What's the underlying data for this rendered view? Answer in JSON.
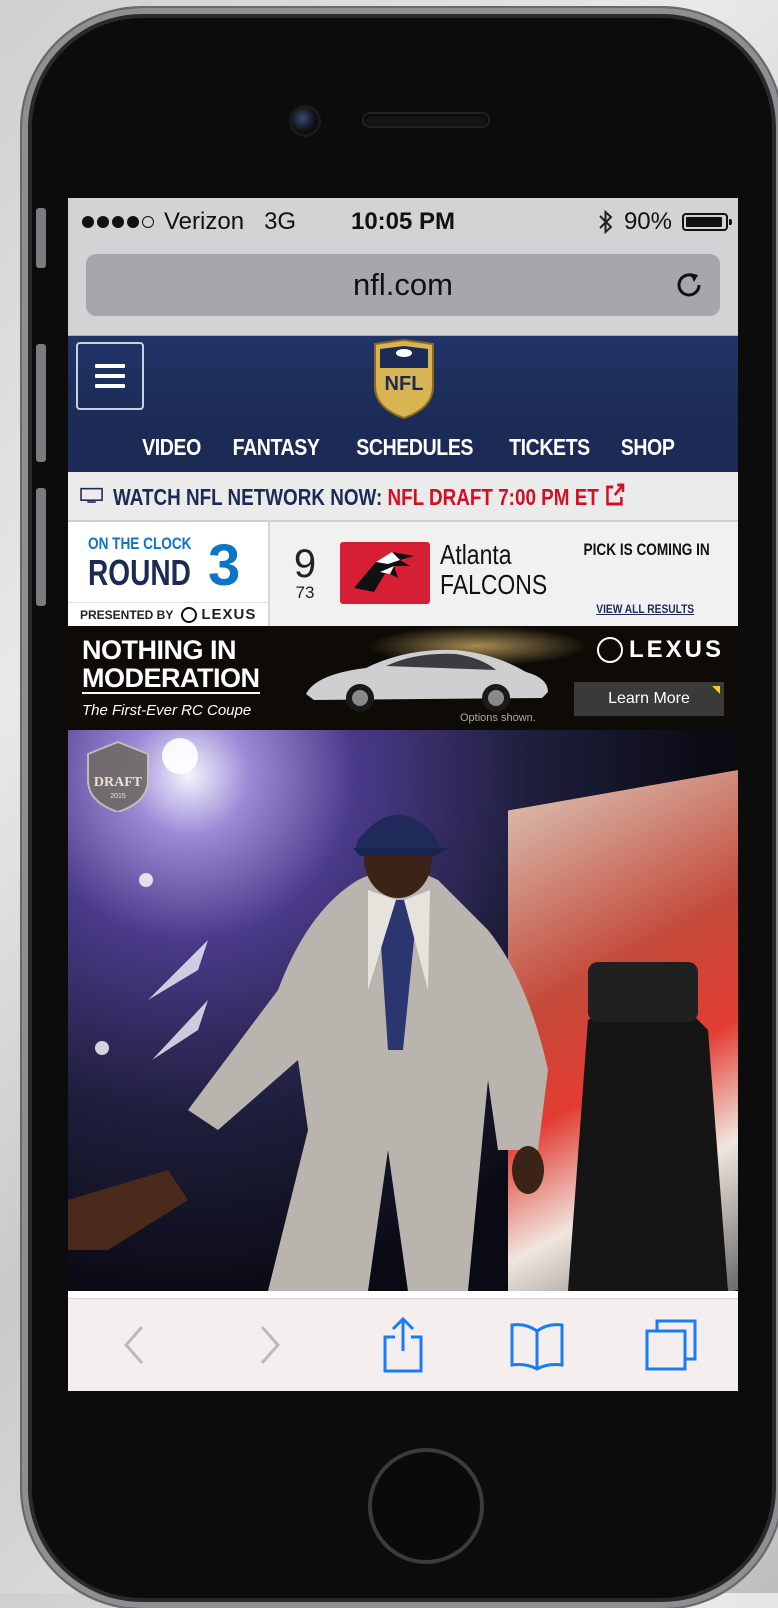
{
  "status_bar": {
    "carrier": "Verizon",
    "network": "3G",
    "time": "10:05 PM",
    "battery": "90%",
    "signal_bars": 4,
    "signal_max": 5
  },
  "browser": {
    "url": "nfl.com"
  },
  "nfl_nav": {
    "items": [
      "VIDEO",
      "FANTASY",
      "SCHEDULES",
      "TICKETS",
      "SHOP"
    ]
  },
  "logo_text": "NFL",
  "watch_banner": {
    "prefix": "WATCH NFL NETWORK NOW:",
    "highlight": "NFL DRAFT 7:00 PM ET"
  },
  "on_the_clock": {
    "label": "ON THE CLOCK",
    "round_label": "ROUND",
    "round_number": "3",
    "presented_by": "PRESENTED BY",
    "sponsor": "LEXUS",
    "pick_number": "9",
    "overall_pick": "73",
    "team_city": "Atlanta",
    "team_name": "FALCONS",
    "status": "PICK IS COMING IN",
    "results_link": "VIEW ALL RESULTS"
  },
  "ad": {
    "headline_line1": "NOTHING IN",
    "headline_line2": "MODERATION",
    "subline": "The First-Ever RC Coupe",
    "disclaimer": "Options shown.",
    "brand": "LEXUS",
    "cta": "Learn More"
  },
  "hero": {
    "badge_text": "DRAFT",
    "badge_year": "2015"
  },
  "colors": {
    "nfl_navy": "#1c2b55",
    "nfl_red": "#d30f24",
    "accent_blue": "#0c75c6",
    "ios_blue": "#1a7cf5"
  }
}
